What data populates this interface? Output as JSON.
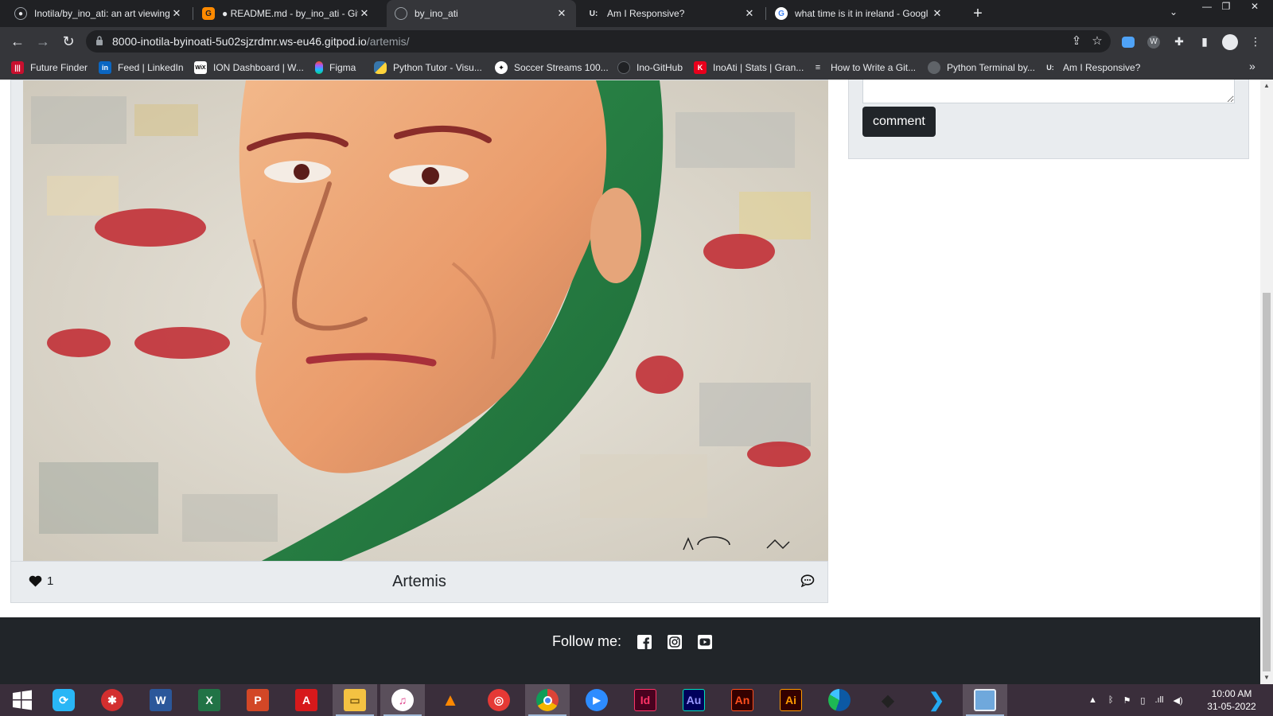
{
  "browser": {
    "tabs": [
      {
        "title": "Inotila/by_ino_ati: an art viewing",
        "icon": "github-icon",
        "active": false
      },
      {
        "title": "● README.md - by_ino_ati - Gitp",
        "icon": "gitpod-icon",
        "active": false
      },
      {
        "title": "by_ino_ati",
        "icon": "globe-icon",
        "active": true
      },
      {
        "title": "Am I Responsive?",
        "icon": "amiresponsive-icon",
        "active": false
      },
      {
        "title": "what time is it in ireland - Googl",
        "icon": "google-icon",
        "active": false
      }
    ],
    "url_host": "8000-inotila-byinoati-5u02sjzrdmr.ws-eu46.gitpod.io",
    "url_path": "/artemis/",
    "bookmarks": [
      {
        "label": "Future Finder",
        "icon": "futurefinder-icon",
        "color": "#c8102e"
      },
      {
        "label": "Feed | LinkedIn",
        "icon": "linkedin-icon",
        "color": "#0a66c2"
      },
      {
        "label": "ION Dashboard | W...",
        "icon": "wix-icon",
        "color": "#ffffff"
      },
      {
        "label": "Figma",
        "icon": "figma-icon",
        "color": "#f24e1e"
      },
      {
        "label": "Python Tutor - Visu...",
        "icon": "python-icon",
        "color": "#3776ab"
      },
      {
        "label": "Soccer Streams 100...",
        "icon": "soccer-ball-icon",
        "color": "#ffffff"
      },
      {
        "label": "Ino-GitHub",
        "icon": "github-icon",
        "color": "#202124"
      },
      {
        "label": "InoAti | Stats | Gran...",
        "icon": "kaggle-icon",
        "color": "#e8001c"
      },
      {
        "label": "How to Write a Git...",
        "icon": "document-icon",
        "color": "#5f6368"
      },
      {
        "label": "Python Terminal by...",
        "icon": "terminal-icon",
        "color": "#5f6368"
      },
      {
        "label": "Am I Responsive?",
        "icon": "amiresponsive-icon",
        "color": "#35363a"
      }
    ]
  },
  "comment_form": {
    "button_label": "comment"
  },
  "artwork": {
    "title": "Artemis",
    "like_count": "1"
  },
  "footer": {
    "follow_label": "Follow me:",
    "social": [
      "facebook-icon",
      "instagram-icon",
      "youtube-icon"
    ]
  },
  "taskbar": {
    "apps": [
      "windows-start-icon",
      "app-icon",
      "app-icon",
      "word-icon",
      "excel-icon",
      "powerpoint-icon",
      "acrobat-icon",
      "file-explorer-icon",
      "itunes-icon",
      "vlc-icon",
      "app-icon",
      "chrome-icon",
      "zoom-icon",
      "indesign-icon",
      "audition-icon",
      "animate-icon",
      "illustrator-icon",
      "edge-icon",
      "app-icon",
      "vscode-icon",
      "app-icon"
    ],
    "app_labels": {
      "indesign": "Id",
      "audition": "Au",
      "animate": "An",
      "illustrator": "Ai",
      "word": "W",
      "excel": "X",
      "powerpoint": "P"
    },
    "time": "10:00 AM",
    "date": "31-05-2022"
  },
  "colors": {
    "page_footer": "#212529",
    "button_dark": "#212529",
    "card_bg": "#e9ecef",
    "chrome_dark": "#35363a"
  }
}
